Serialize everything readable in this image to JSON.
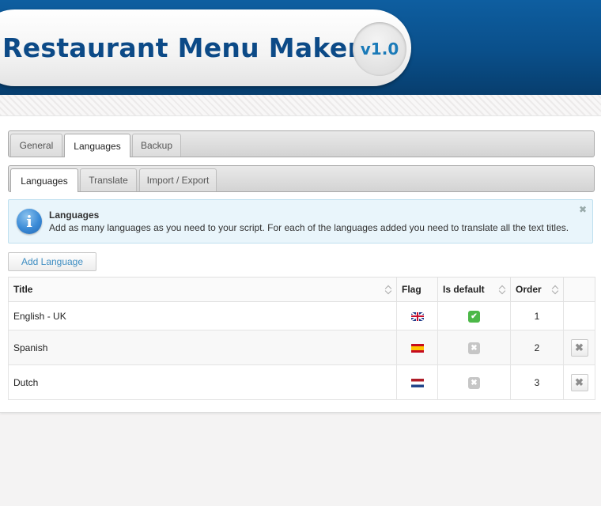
{
  "app": {
    "title": "Restaurant Menu Maker",
    "version": "v1.0"
  },
  "main_tabs": [
    {
      "label": "General",
      "active": false
    },
    {
      "label": "Languages",
      "active": true
    },
    {
      "label": "Backup",
      "active": false
    }
  ],
  "sub_tabs": [
    {
      "label": "Languages",
      "active": true
    },
    {
      "label": "Translate",
      "active": false
    },
    {
      "label": "Import / Export",
      "active": false
    }
  ],
  "notice": {
    "icon": "info-icon",
    "title": "Languages",
    "text": "Add as many languages as you need to your script. For each of the languages added you need to translate all the text titles.",
    "close_glyph": "✖"
  },
  "add_button_label": "Add Language",
  "table": {
    "columns": [
      "Title",
      "Flag",
      "Is default",
      "Order"
    ],
    "rows": [
      {
        "title": "English - UK",
        "flag": "uk-flag",
        "is_default": true,
        "is_default_glyph": "✔",
        "order": "1",
        "deletable": false
      },
      {
        "title": "Spanish",
        "flag": "spain-flag",
        "is_default": false,
        "is_default_glyph": "✖",
        "order": "2",
        "deletable": true,
        "delete_glyph": "✖"
      },
      {
        "title": "Dutch",
        "flag": "netherlands-flag",
        "is_default": false,
        "is_default_glyph": "✖",
        "order": "3",
        "deletable": true,
        "delete_glyph": "✖"
      }
    ]
  },
  "colors": {
    "header_blue": "#0a4f8a",
    "logo_text": "#0c4a87",
    "accent_link": "#3f8ec2",
    "default_yes": "#4cb848",
    "default_no": "#c6c6c6",
    "notice_bg": "#e9f5fb"
  }
}
